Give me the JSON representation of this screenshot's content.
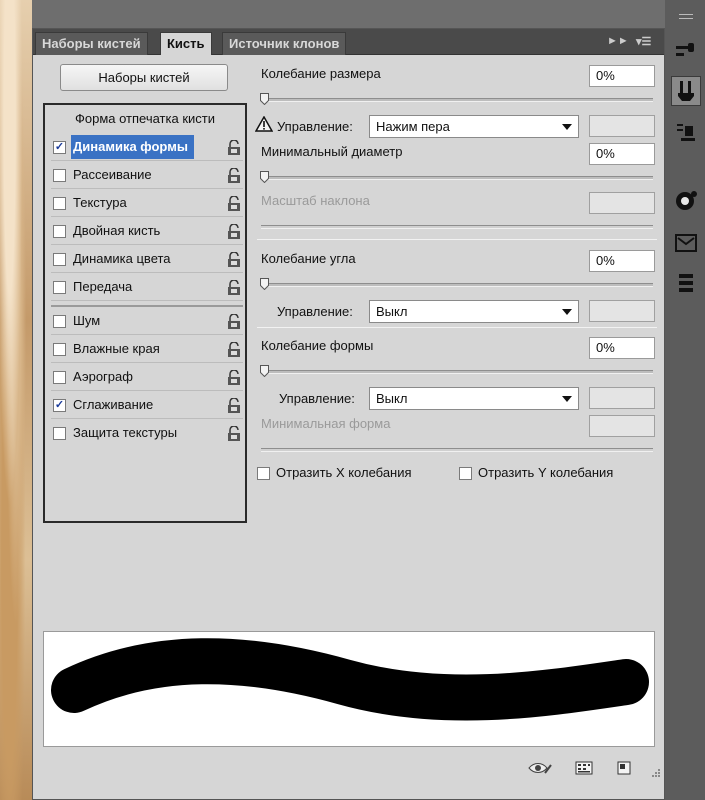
{
  "tabs": [
    {
      "label": "Наборы кистей"
    },
    {
      "label": "Кисть"
    },
    {
      "label": "Источник клонов"
    }
  ],
  "presets_button": "Наборы кистей",
  "list": {
    "title": "Форма отпечатка кисти",
    "items": [
      {
        "label": "Динамика формы",
        "checked": true,
        "selected": true
      },
      {
        "label": "Рассеивание",
        "checked": false
      },
      {
        "label": "Текстура",
        "checked": false
      },
      {
        "label": "Двойная кисть",
        "checked": false
      },
      {
        "label": "Динамика цвета",
        "checked": false
      },
      {
        "label": "Передача",
        "checked": false
      },
      {
        "label": "Шум",
        "checked": false
      },
      {
        "label": "Влажные края",
        "checked": false
      },
      {
        "label": "Аэрограф",
        "checked": false
      },
      {
        "label": "Сглаживание",
        "checked": true
      },
      {
        "label": "Защита текстуры",
        "checked": false
      }
    ]
  },
  "settings": {
    "size_jitter": {
      "label": "Колебание размера",
      "value": "0%"
    },
    "size_control": {
      "label": "Управление:",
      "value": "Нажим пера"
    },
    "min_diameter": {
      "label": "Минимальный диаметр",
      "value": "0%"
    },
    "tilt_scale": {
      "label": "Масштаб наклона"
    },
    "angle_jitter": {
      "label": "Колебание угла",
      "value": "0%"
    },
    "angle_control": {
      "label": "Управление:",
      "value": "Выкл"
    },
    "roundness_jitter": {
      "label": "Колебание формы",
      "value": "0%"
    },
    "roundness_control": {
      "label": "Управление:",
      "value": "Выкл"
    },
    "min_roundness": {
      "label": "Минимальная форма"
    },
    "flip_x": {
      "label": "Отразить X колебания",
      "checked": false
    },
    "flip_y": {
      "label": "Отразить Y колебания",
      "checked": false
    }
  },
  "checkmark": "✓"
}
